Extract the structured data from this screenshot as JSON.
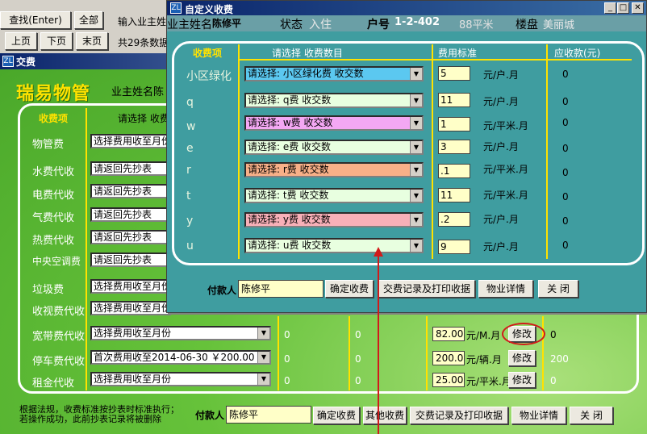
{
  "top": {
    "query_btn": "查找(Enter)",
    "all_btn": "全部",
    "search_hint": "输入业主姓",
    "prev_btn": "上页",
    "next_btn": "下页",
    "last_btn": "末页",
    "record_count": "共29条数据"
  },
  "bg_window": {
    "title": "交费",
    "brand": "瑞易物管",
    "owner_label": "业主姓名陈",
    "col_item": "收费项",
    "col_select": "请选择 收费",
    "rows": [
      {
        "label": "物管费",
        "select": "选择费用收至月份"
      },
      {
        "label": "水费代收",
        "select": "请返回先抄表"
      },
      {
        "label": "电费代收",
        "select": "请返回先抄表"
      },
      {
        "label": "气费代收",
        "select": "请返回先抄表"
      },
      {
        "label": "热费代收",
        "select": "请返回先抄表"
      },
      {
        "label": "中央空调费",
        "select": "请返回先抄表"
      },
      {
        "label": "垃圾费",
        "select": "选择费用收至月份"
      },
      {
        "label": "收视费代收",
        "select": "选择费用收至月份"
      },
      {
        "label": "宽带费代收",
        "select": "选择费用收至月份",
        "a": "0",
        "b": "0",
        "price": "82.00",
        "unit": "元/M.月",
        "btn": "修改",
        "due": "0"
      },
      {
        "label": "停车费代收",
        "select": "首次费用收至2014-06-30 ￥200.00",
        "a": "0",
        "b": "0",
        "price": "200.00",
        "unit": "元/辆.月",
        "btn": "修改",
        "due": "200"
      },
      {
        "label": "租金代收",
        "select": "选择费用收至月份",
        "a": "0",
        "b": "0",
        "price": "25.00",
        "unit": "元/平米.月",
        "btn": "修改",
        "due": "0"
      }
    ],
    "note_line1": "根据法规，收费标准按抄表时标准执行；",
    "note_line2": "若操作成功，此前抄表记录将被删除",
    "payer_label": "付款人",
    "payer_value": "陈修平",
    "confirm_btn": "确定收费",
    "other_btn": "其他收费",
    "print_btn": "交费记录及打印收据",
    "detail_btn": "物业详情",
    "close_btn": "关 闭"
  },
  "dialog": {
    "title": "自定义收费",
    "owner_label": "业主姓名",
    "owner_value": "陈修平",
    "status_label": "状态",
    "status_value": "入住",
    "unit_label": "户号",
    "unit_value": "1-2-402",
    "area_value": "88平米",
    "estate_label": "楼盘",
    "estate_value": "美丽城",
    "col_item": "收费项",
    "col_select": "请选择 收费数目",
    "col_std": "费用标准",
    "col_due": "应收款(元)",
    "rows": [
      {
        "label": "小区绿化",
        "select": "请选择: 小区绿化费 收交数",
        "color": "#5bc8f0",
        "value": "5",
        "unit": "元/户.月",
        "due": "0"
      },
      {
        "label": "q",
        "select": "请选择: q费 收交数",
        "color": "#e8ffe0",
        "value": "11",
        "unit": "元/户.月",
        "due": "0"
      },
      {
        "label": "w",
        "select": "请选择: w费 收交数",
        "color": "#f4a8f4",
        "value": "1",
        "unit": "元/平米.月",
        "due": "0"
      },
      {
        "label": "e",
        "select": "请选择: e费 收交数",
        "color": "#e8ffe0",
        "value": "3",
        "unit": "元/户.月",
        "due": "0"
      },
      {
        "label": "r",
        "select": "请选择: r费 收交数",
        "color": "#f8b088",
        "value": ".1",
        "unit": "元/平米.月",
        "due": "0"
      },
      {
        "label": "t",
        "select": "请选择: t费 收交数",
        "color": "#e8ffe0",
        "value": "11",
        "unit": "元/平米.月",
        "due": "0"
      },
      {
        "label": "y",
        "select": "请选择: y费 收交数",
        "color": "#f8b0b8",
        "value": ".2",
        "unit": "元/户.月",
        "due": "0"
      },
      {
        "label": "u",
        "select": "请选择: u费 收交数",
        "color": "#e8ffe0",
        "value": "9",
        "unit": "元/户.月",
        "due": "0"
      }
    ],
    "payer_label": "付款人",
    "payer_value": "陈修平",
    "confirm_btn": "确定收费",
    "print_btn": "交费记录及打印收据",
    "detail_btn": "物业详情",
    "close_btn": "关 闭"
  }
}
